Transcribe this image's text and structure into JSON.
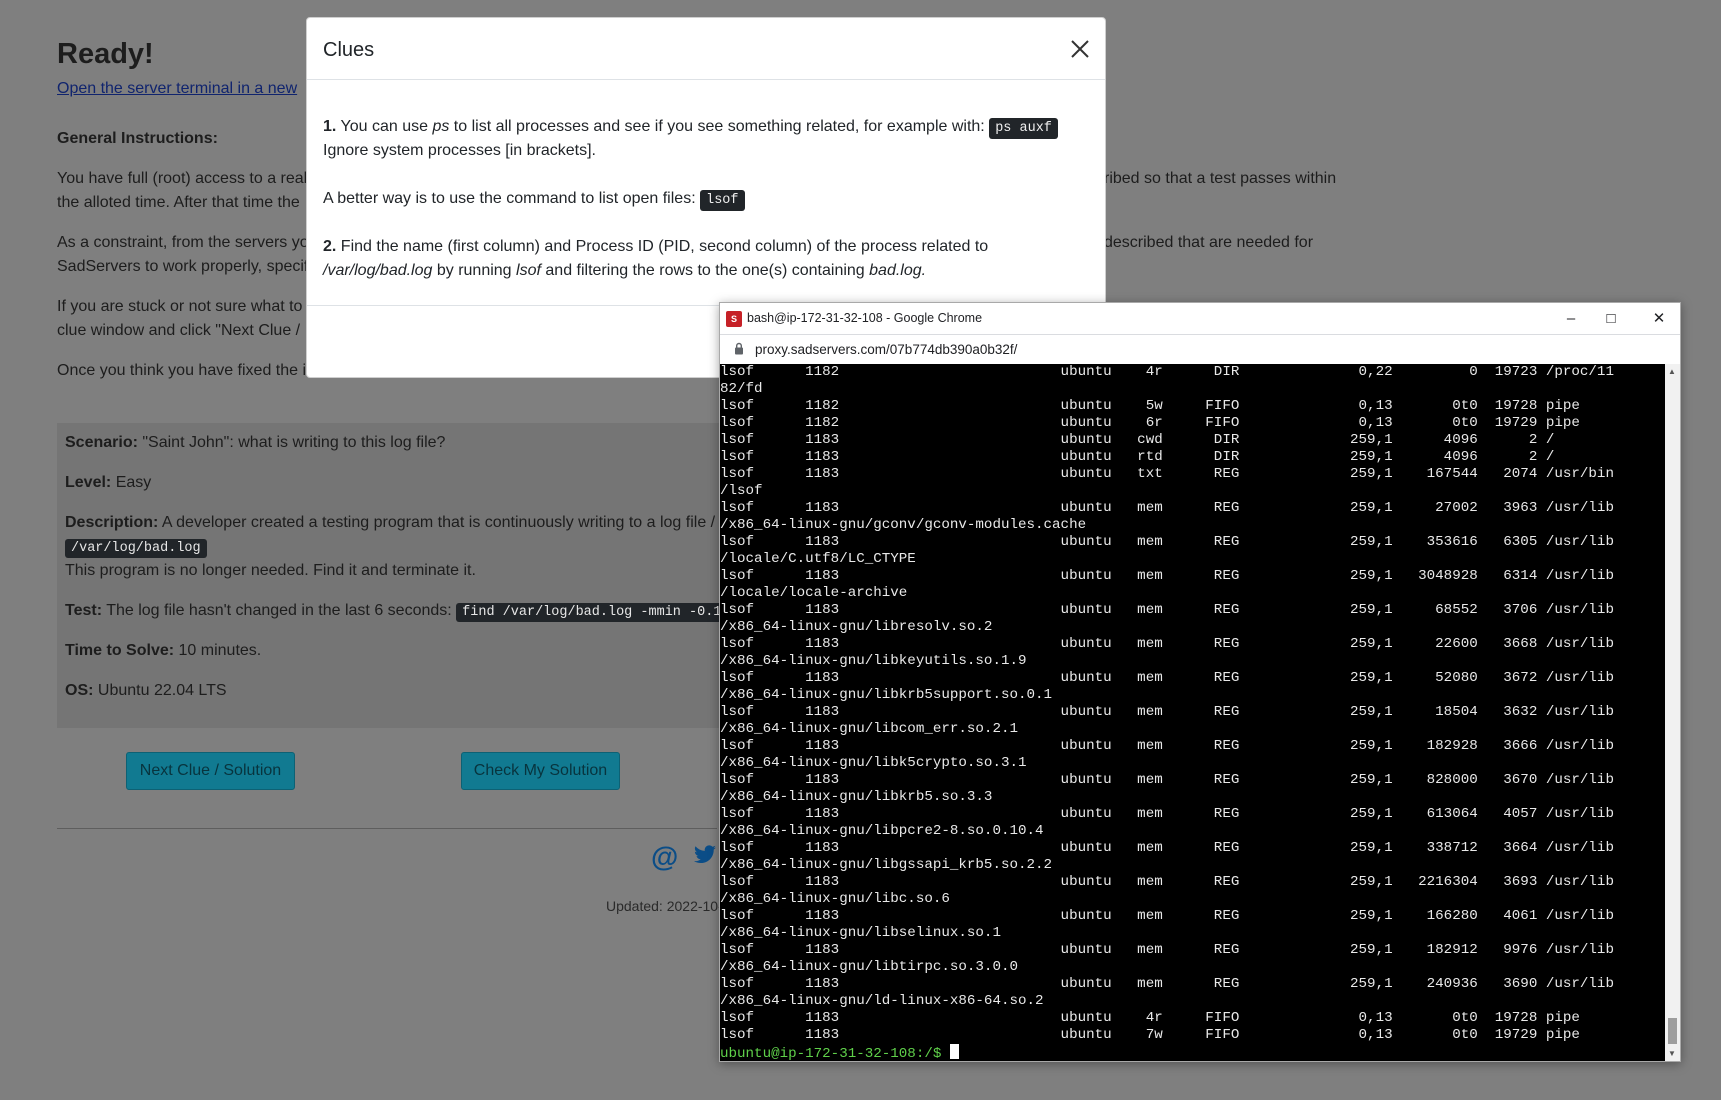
{
  "page": {
    "heading": "Ready!",
    "terminal_link": "Open the server terminal in a new",
    "general_title": "General Instructions:",
    "paragraphs": [
      [
        "You have full (root) access to a real",
        "ribed so that a test passes within"
      ],
      [
        "the alloted time. After that time the",
        ""
      ],
      [
        "As a constraint, from the servers yo",
        "described that are needed for"
      ],
      [
        "SadServers to work properly, specifi",
        ""
      ],
      [
        "If you are stuck or not sure what to",
        ""
      ],
      [
        "clue window and click \"Next Clue /",
        ""
      ],
      [
        "Once you think you have fixed the i",
        ""
      ]
    ],
    "scenario_label": "Scenario:",
    "scenario_value": "\"Saint John\": what is writing to this log file?",
    "level_label": "Level:",
    "level_value": "Easy",
    "description_label": "Description:",
    "description_value": "A developer created a testing program that is continuously writing to a log file /",
    "description_code": "/var/log/bad.log",
    "description_line2": "This program is no longer needed. Find it and terminate it.",
    "test_label": "Test:",
    "test_value": "The log file hasn't changed in the last 6 seconds:",
    "test_code": "find /var/log/bad.log -mmin -0.1",
    "time_label": "Time to Solve:",
    "time_value": "10 minutes.",
    "os_label": "OS:",
    "os_value": "Ubuntu 22.04 LTS",
    "next_clue_button": "Next Clue / Solution",
    "check_solution_button": "Check My Solution",
    "updated": "Updated: 2022-10-"
  },
  "modal": {
    "title": "Clues",
    "clue1_num": "1.",
    "clue1_text_a": "You can use",
    "clue1_em": "ps",
    "clue1_text_b": "to list all processes and see if you see something related, for example with:",
    "clue1_code": "ps auxf",
    "clue1_line2": "Ignore system processes [in brackets].",
    "clue_lsof_text": "A better way is to use the command to list open files:",
    "clue_lsof_code": "lsof",
    "clue2_num": "2.",
    "clue2_text": "Find the name (first column) and Process ID (PID, second column) of the process related to",
    "clue2_em1": "/var/log/bad.log",
    "clue2_text_b": "by running",
    "clue2_em2": "lsof",
    "clue2_text_c": "and filtering the rows to the one(s) containing",
    "clue2_em3": "bad.log."
  },
  "terminal": {
    "window_title": "bash@ip-172-31-32-108 - Google Chrome",
    "url": "proxy.sadservers.com/07b774db390a0b32f/",
    "lines": [
      "lsof      1182                          ubuntu    4r      DIR              0,22         0  19723 /proc/11",
      "82/fd",
      "lsof      1182                          ubuntu    5w     FIFO              0,13       0t0  19728 pipe",
      "lsof      1182                          ubuntu    6r     FIFO              0,13       0t0  19729 pipe",
      "lsof      1183                          ubuntu   cwd      DIR             259,1      4096      2 /",
      "lsof      1183                          ubuntu   rtd      DIR             259,1      4096      2 /",
      "lsof      1183                          ubuntu   txt      REG             259,1    167544   2074 /usr/bin",
      "/lsof",
      "lsof      1183                          ubuntu   mem      REG             259,1     27002   3963 /usr/lib",
      "/x86_64-linux-gnu/gconv/gconv-modules.cache",
      "lsof      1183                          ubuntu   mem      REG             259,1    353616   6305 /usr/lib",
      "/locale/C.utf8/LC_CTYPE",
      "lsof      1183                          ubuntu   mem      REG             259,1   3048928   6314 /usr/lib",
      "/locale/locale-archive",
      "lsof      1183                          ubuntu   mem      REG             259,1     68552   3706 /usr/lib",
      "/x86_64-linux-gnu/libresolv.so.2",
      "lsof      1183                          ubuntu   mem      REG             259,1     22600   3668 /usr/lib",
      "/x86_64-linux-gnu/libkeyutils.so.1.9",
      "lsof      1183                          ubuntu   mem      REG             259,1     52080   3672 /usr/lib",
      "/x86_64-linux-gnu/libkrb5support.so.0.1",
      "lsof      1183                          ubuntu   mem      REG             259,1     18504   3632 /usr/lib",
      "/x86_64-linux-gnu/libcom_err.so.2.1",
      "lsof      1183                          ubuntu   mem      REG             259,1    182928   3666 /usr/lib",
      "/x86_64-linux-gnu/libk5crypto.so.3.1",
      "lsof      1183                          ubuntu   mem      REG             259,1    828000   3670 /usr/lib",
      "/x86_64-linux-gnu/libkrb5.so.3.3",
      "lsof      1183                          ubuntu   mem      REG             259,1    613064   4057 /usr/lib",
      "/x86_64-linux-gnu/libpcre2-8.so.0.10.4",
      "lsof      1183                          ubuntu   mem      REG             259,1    338712   3664 /usr/lib",
      "/x86_64-linux-gnu/libgssapi_krb5.so.2.2",
      "lsof      1183                          ubuntu   mem      REG             259,1   2216304   3693 /usr/lib",
      "/x86_64-linux-gnu/libc.so.6",
      "lsof      1183                          ubuntu   mem      REG             259,1    166280   4061 /usr/lib",
      "/x86_64-linux-gnu/libselinux.so.1",
      "lsof      1183                          ubuntu   mem      REG             259,1    182912   9976 /usr/lib",
      "/x86_64-linux-gnu/libtirpc.so.3.0.0",
      "lsof      1183                          ubuntu   mem      REG             259,1    240936   3690 /usr/lib",
      "/x86_64-linux-gnu/ld-linux-x86-64.so.2",
      "lsof      1183                          ubuntu    4r     FIFO              0,13       0t0  19728 pipe",
      "lsof      1183                          ubuntu    7w     FIFO              0,13       0t0  19729 pipe"
    ],
    "prompt": "ubuntu@ip-172-31-32-108:/$ "
  }
}
